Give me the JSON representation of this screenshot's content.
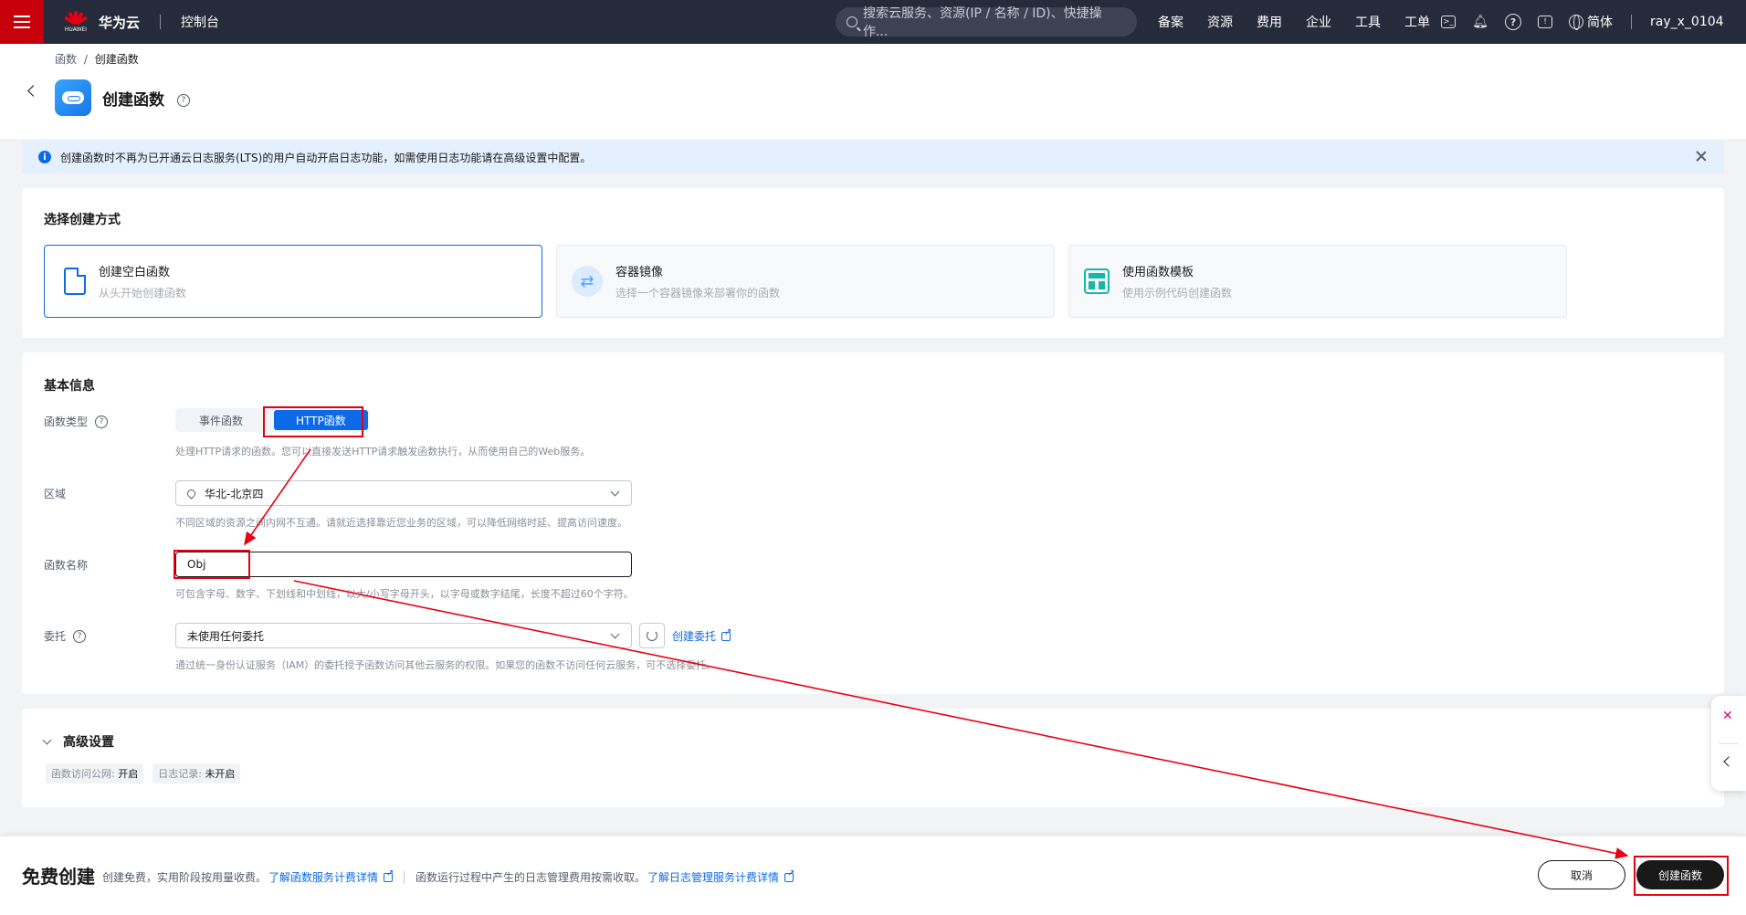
{
  "topbar": {
    "logo_sub": "HUAWEI",
    "brand": "华为云",
    "console": "控制台",
    "search_placeholder": "搜索云服务、资源(IP / 名称 / ID)、快捷操作...",
    "nav": [
      "备案",
      "资源",
      "费用",
      "企业",
      "工具",
      "工单"
    ],
    "lang": "简体",
    "user": "ray_x_0104"
  },
  "breadcrumb": {
    "parent": "函数",
    "separator": "/",
    "current": "创建函数"
  },
  "page_title": "创建函数",
  "banner": {
    "text": "创建函数时不再为已开通云日志服务(LTS)的用户自动开启日志功能，如需使用日志功能请在高级设置中配置。"
  },
  "method_section": {
    "title": "选择创建方式",
    "options": [
      {
        "title": "创建空白函数",
        "subtitle": "从头开始创建函数",
        "icon": "blank-file-icon"
      },
      {
        "title": "容器镜像",
        "subtitle": "选择一个容器镜像来部署你的函数",
        "icon": "container-image-icon"
      },
      {
        "title": "使用函数模板",
        "subtitle": "使用示例代码创建函数",
        "icon": "template-icon"
      }
    ],
    "selected": 0
  },
  "basic": {
    "title": "基本信息",
    "type_label": "函数类型",
    "type_options": [
      "事件函数",
      "HTTP函数"
    ],
    "type_selected": "HTTP函数",
    "type_hint": "处理HTTP请求的函数。您可以直接发送HTTP请求触发函数执行，从而使用自己的Web服务。",
    "region_label": "区域",
    "region_value": "华北-北京四",
    "region_hint": "不同区域的资源之间内网不互通。请就近选择靠近您业务的区域，可以降低网络时延、提高访问速度。",
    "name_label": "函数名称",
    "name_value": "Obj",
    "name_hint": "可包含字母、数字、下划线和中划线，以大/小写字母开头，以字母或数字结尾，长度不超过60个字符。",
    "agency_label": "委托",
    "agency_value": "未使用任何委托",
    "agency_link": "创建委托",
    "agency_hint": "通过统一身份认证服务（IAM）的委托授予函数访问其他云服务的权限。如果您的函数不访问任何云服务，可不选择委托。"
  },
  "advanced": {
    "title": "高级设置",
    "tags": [
      {
        "label": "函数访问公网:",
        "value": "开启"
      },
      {
        "label": "日志记录:",
        "value": "未开启"
      }
    ]
  },
  "footer": {
    "title": "免费创建",
    "text1": "创建免费，实用阶段按用量收费。",
    "link1": "了解函数服务计费详情",
    "text2": "函数运行过程中产生的日志管理费用按需收取。",
    "link2": "了解日志管理服务计费详情",
    "cancel": "取消",
    "create": "创建函数"
  },
  "colors": {
    "accent": "#0d6ae6",
    "annotation": "#e60012",
    "topbar": "#252b3a",
    "menu": "#c7000b"
  }
}
